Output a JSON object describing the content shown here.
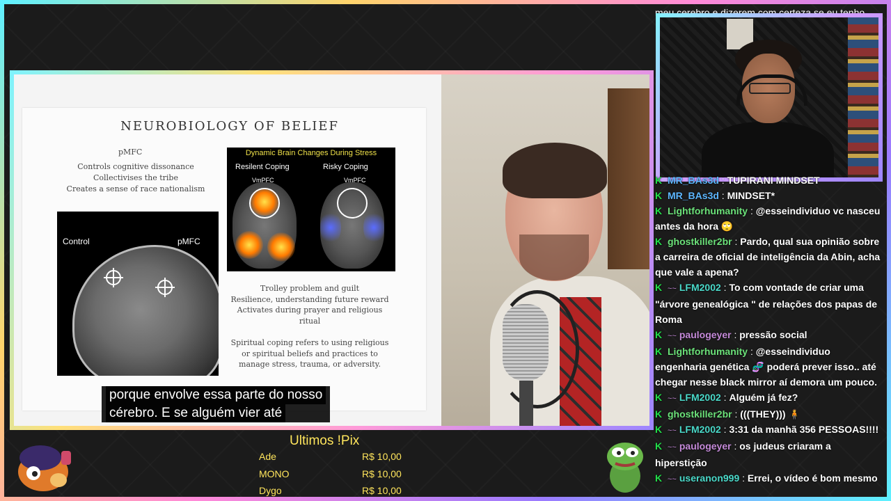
{
  "chat_cutoff_text": "meu cerebro e dizerem com certeza se eu tenho",
  "slide": {
    "title": "NEUROBIOLOGY OF BELIEF",
    "pmfc_heading": "pMFC",
    "pmfc_lines": [
      "Controls cognitive dissonance",
      "Collectivises the tribe",
      "Creates a sense of race nationalism"
    ],
    "mri_label_control": "Control",
    "mri_label_pmfc": "pMFC",
    "scan_heading": "Dynamic Brain Changes During Stress",
    "scan_resilient": "Resilent Coping",
    "scan_risky": "Risky Coping",
    "scan_vmpfc_left": "VmPFC",
    "scan_vmpfc_right": "VmPFC",
    "trolley_lines": [
      "Trolley problem and guilt",
      "Resilience, understanding future reward",
      "Activates during prayer and religious",
      "ritual"
    ],
    "spiritual_lines": [
      "Spiritual coping refers to using religious",
      "or spiritual beliefs and practices to",
      "manage stress, trauma, or adversity."
    ]
  },
  "caption": {
    "line1": "porque envolve essa parte do nosso",
    "line2": "cérebro. E se alguém vier até"
  },
  "chat": [
    {
      "user": "MR_BAs3d",
      "user_color": "#5db7ff",
      "sub": "",
      "text": "TUPIRANI MINDSET"
    },
    {
      "user": "MR_BAs3d",
      "user_color": "#5db7ff",
      "sub": "",
      "text": "MINDSET*"
    },
    {
      "user": "Lightforhumanity",
      "user_color": "#6ce27a",
      "sub": "",
      "text": "@esseindividuo vc nasceu antes da hora 🙄"
    },
    {
      "user": "ghostkiller2br",
      "user_color": "#6ce27a",
      "sub": "",
      "text": "Pardo, qual sua opinião sobre a carreira de oficial de inteligência da Abin, acha que vale a apena?"
    },
    {
      "user": "LFM2002",
      "user_color": "#4ad9c9",
      "sub": "~~",
      "text": "To com vontade de criar uma \"árvore genealógica \" de relações dos papas de Roma"
    },
    {
      "user": "paulogeyer",
      "user_color": "#c58ad9",
      "sub": "~~",
      "text": "pressão social"
    },
    {
      "user": "Lightforhumanity",
      "user_color": "#6ce27a",
      "sub": "",
      "text": "@esseindividuo engenharia genética 🧬 poderá prever isso.. até chegar nesse black mirror aí demora um pouco."
    },
    {
      "user": "LFM2002",
      "user_color": "#4ad9c9",
      "sub": "~~",
      "text": "Alguém já fez?"
    },
    {
      "user": "ghostkiller2br",
      "user_color": "#6ce27a",
      "sub": "",
      "text": "(((THEY))) 🧍"
    },
    {
      "user": "LFM2002",
      "user_color": "#4ad9c9",
      "sub": "~~",
      "text": "3:31 da manhã 356 PESSOAS!!!!"
    },
    {
      "user": "paulogeyer",
      "user_color": "#c58ad9",
      "sub": "~~",
      "text": "os judeus criaram a hiperstição"
    },
    {
      "user": "useranon999",
      "user_color": "#4ad9c9",
      "sub": "~~",
      "text": "Errei, o vídeo é bom mesmo"
    }
  ],
  "pix": {
    "title": "Ultimos !Pix",
    "rows": [
      {
        "name": "Ade",
        "amount": "R$ 10,00"
      },
      {
        "name": "MONO",
        "amount": "R$ 10,00"
      },
      {
        "name": "Dygo",
        "amount": "R$ 10,00"
      }
    ]
  },
  "colors": {
    "pix_text": "#ffe55c",
    "badge_green": "#22e04a",
    "frame_gradient": [
      "#5ff0ff",
      "#ffd46b",
      "#ff8ad8",
      "#9b7bff"
    ]
  }
}
